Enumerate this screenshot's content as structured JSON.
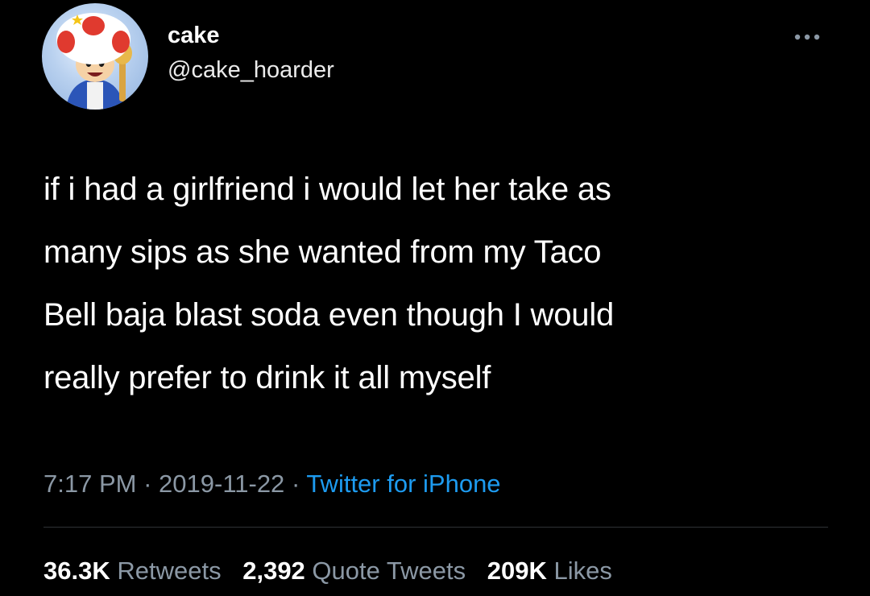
{
  "author": {
    "display_name": "cake",
    "handle": "@cake_hoarder",
    "avatar": "toad-character-avatar"
  },
  "more_icon": "more-horizontal-icon",
  "tweet": {
    "text_lines": [
      "if i had a girlfriend i would let her take as",
      "many sips as she wanted from my Taco",
      "Bell baja blast soda even though I would",
      "really prefer to drink it all myself"
    ]
  },
  "meta": {
    "time": "7:17 PM",
    "separator": "·",
    "date": "2019-11-22",
    "source": "Twitter for iPhone"
  },
  "stats": {
    "retweets_count": "36.3K",
    "retweets_label": "Retweets",
    "quotes_count": "2,392",
    "quotes_label": "Quote Tweets",
    "likes_count": "209K",
    "likes_label": "Likes"
  },
  "colors": {
    "background": "#000000",
    "text": "#ffffff",
    "secondary": "#8b98a5",
    "link": "#1d9bf0"
  }
}
